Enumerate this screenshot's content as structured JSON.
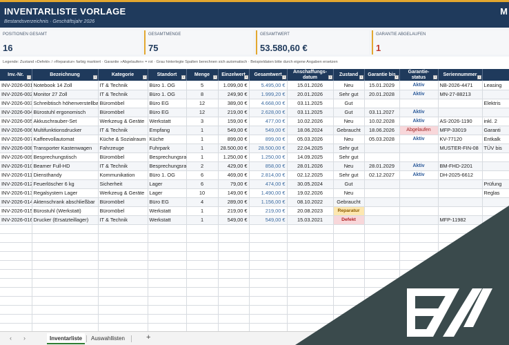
{
  "header": {
    "title": "INVENTARLISTE VORLAGE",
    "subtitle": "Bestandsverzeichnis · Geschäftsjahr 2026",
    "corner": "M"
  },
  "kpis": [
    {
      "label": "POSITIONEN GESAMT",
      "value": "16"
    },
    {
      "label": "GESAMTMENGE",
      "value": "75"
    },
    {
      "label": "GESAMTWERT",
      "value": "53.580,60 €"
    },
    {
      "label": "GARANTIE ABGELAUFEN",
      "value": "1"
    }
  ],
  "legend": "Legende:  Zustand »Defekt« / »Reparatur« farbig markiert   ·   Garantie »Abgelaufen« = rot   ·   Grau hinterlegte Spalten berechnen sich automatisch   ·   Beispieldaten bitte durch eigene Angaben ersetzen",
  "columns": [
    "Inv.-Nr.",
    "Bezeichnung",
    "Kategorie",
    "Standort",
    "Menge",
    "Einzelwert",
    "Gesamtwert",
    "Anschaffungs-\ndatum",
    "Zustand",
    "Garantie bis",
    "Garantie-\nstatus",
    "Seriennummer",
    ""
  ],
  "rows": [
    [
      "INV-2026-001",
      "Notebook 14 Zoll",
      "IT & Technik",
      "Büro 1. OG",
      "5",
      "1.099,00 €",
      "5.495,00 €",
      "15.01.2026",
      "Neu",
      "15.01.2029",
      "Aktiv",
      "NB-2026-4471",
      "Leasing"
    ],
    [
      "INV-2026-002",
      "Monitor 27 Zoll",
      "IT & Technik",
      "Büro 1. OG",
      "8",
      "249,90 €",
      "1.999,20 €",
      "20.01.2026",
      "Sehr gut",
      "20.01.2028",
      "Aktiv",
      "MN-27-88213",
      ""
    ],
    [
      "INV-2026-003",
      "Schreibtisch höhenverstellbar",
      "Büromöbel",
      "Büro EG",
      "12",
      "389,00 €",
      "4.668,00 €",
      "03.11.2025",
      "Gut",
      "",
      "",
      "",
      "Elektris"
    ],
    [
      "INV-2026-004",
      "Bürostuhl ergonomisch",
      "Büromöbel",
      "Büro EG",
      "12",
      "219,00 €",
      "2.628,00 €",
      "03.11.2025",
      "Gut",
      "03.11.2027",
      "Aktiv",
      "",
      ""
    ],
    [
      "INV-2026-005",
      "Akkuschrauber-Set",
      "Werkzeug & Geräte",
      "Werkstatt",
      "3",
      "159,00 €",
      "477,00 €",
      "10.02.2026",
      "Neu",
      "10.02.2028",
      "Aktiv",
      "AS-2026-1190",
      "inkl. 2"
    ],
    [
      "INV-2026-006",
      "Multifunktionsdrucker",
      "IT & Technik",
      "Empfang",
      "1",
      "549,00 €",
      "549,00 €",
      "18.06.2024",
      "Gebraucht",
      "18.06.2026",
      "Abgelaufen",
      "MFP-33019",
      "Garanti"
    ],
    [
      "INV-2026-007",
      "Kaffeevollautomat",
      "Küche & Sozialraum",
      "Küche",
      "1",
      "899,00 €",
      "899,00 €",
      "05.03.2026",
      "Neu",
      "05.03.2028",
      "Aktiv",
      "KV-77120",
      "Entkalk"
    ],
    [
      "INV-2026-008",
      "Transporter Kastenwagen",
      "Fahrzeuge",
      "Fuhrpark",
      "1",
      "28.500,00 €",
      "28.500,00 €",
      "22.04.2025",
      "Sehr gut",
      "",
      "",
      "MUSTER-FIN-08",
      "TÜV bis"
    ],
    [
      "INV-2026-009",
      "Besprechungstisch",
      "Büromöbel",
      "Besprechungsraum",
      "1",
      "1.250,00 €",
      "1.250,00 €",
      "14.09.2025",
      "Sehr gut",
      "",
      "",
      "",
      ""
    ],
    [
      "INV-2026-010",
      "Beamer Full-HD",
      "IT & Technik",
      "Besprechungsraum",
      "2",
      "429,00 €",
      "858,00 €",
      "28.01.2026",
      "Neu",
      "28.01.2029",
      "Aktiv",
      "BM-FHD-2201",
      ""
    ],
    [
      "INV-2026-011",
      "Diensthandy",
      "Kommunikation",
      "Büro 1. OG",
      "6",
      "469,00 €",
      "2.814,00 €",
      "02.12.2025",
      "Sehr gut",
      "02.12.2027",
      "Aktiv",
      "DH-2025-6612",
      ""
    ],
    [
      "INV-2026-012",
      "Feuerlöscher 6 kg",
      "Sicherheit",
      "Lager",
      "6",
      "79,00 €",
      "474,00 €",
      "30.05.2024",
      "Gut",
      "",
      "",
      "",
      "Prüfung"
    ],
    [
      "INV-2026-013",
      "Regalsystem Lager",
      "Werkzeug & Geräte",
      "Lager",
      "10",
      "149,00 €",
      "1.490,00 €",
      "19.02.2026",
      "Neu",
      "",
      "",
      "",
      "Reglas"
    ],
    [
      "INV-2026-014",
      "Aktenschrank abschließbar",
      "Büromöbel",
      "Büro EG",
      "4",
      "289,00 €",
      "1.156,00 €",
      "08.10.2022",
      "Gebraucht",
      "",
      "",
      "",
      ""
    ],
    [
      "INV-2026-015",
      "Bürostuhl (Werkstatt)",
      "Büromöbel",
      "Werkstatt",
      "1",
      "219,00 €",
      "219,00 €",
      "20.08.2023",
      "Reparatur",
      "",
      "",
      "",
      ""
    ],
    [
      "INV-2026-016",
      "Drucker (Ersatzteillager)",
      "IT & Technik",
      "Werkstatt",
      "1",
      "549,00 €",
      "549,00 €",
      "15.03.2021",
      "Defekt",
      "",
      "",
      "MFP-11982",
      ""
    ]
  ],
  "tabs": {
    "nav_prev": "‹",
    "nav_next": "›",
    "sheet1": "Inventarliste",
    "sheet2": "Auswahllisten",
    "add": "+"
  },
  "watermark": {
    "text": "EW",
    "color": "#3a4a4c"
  }
}
